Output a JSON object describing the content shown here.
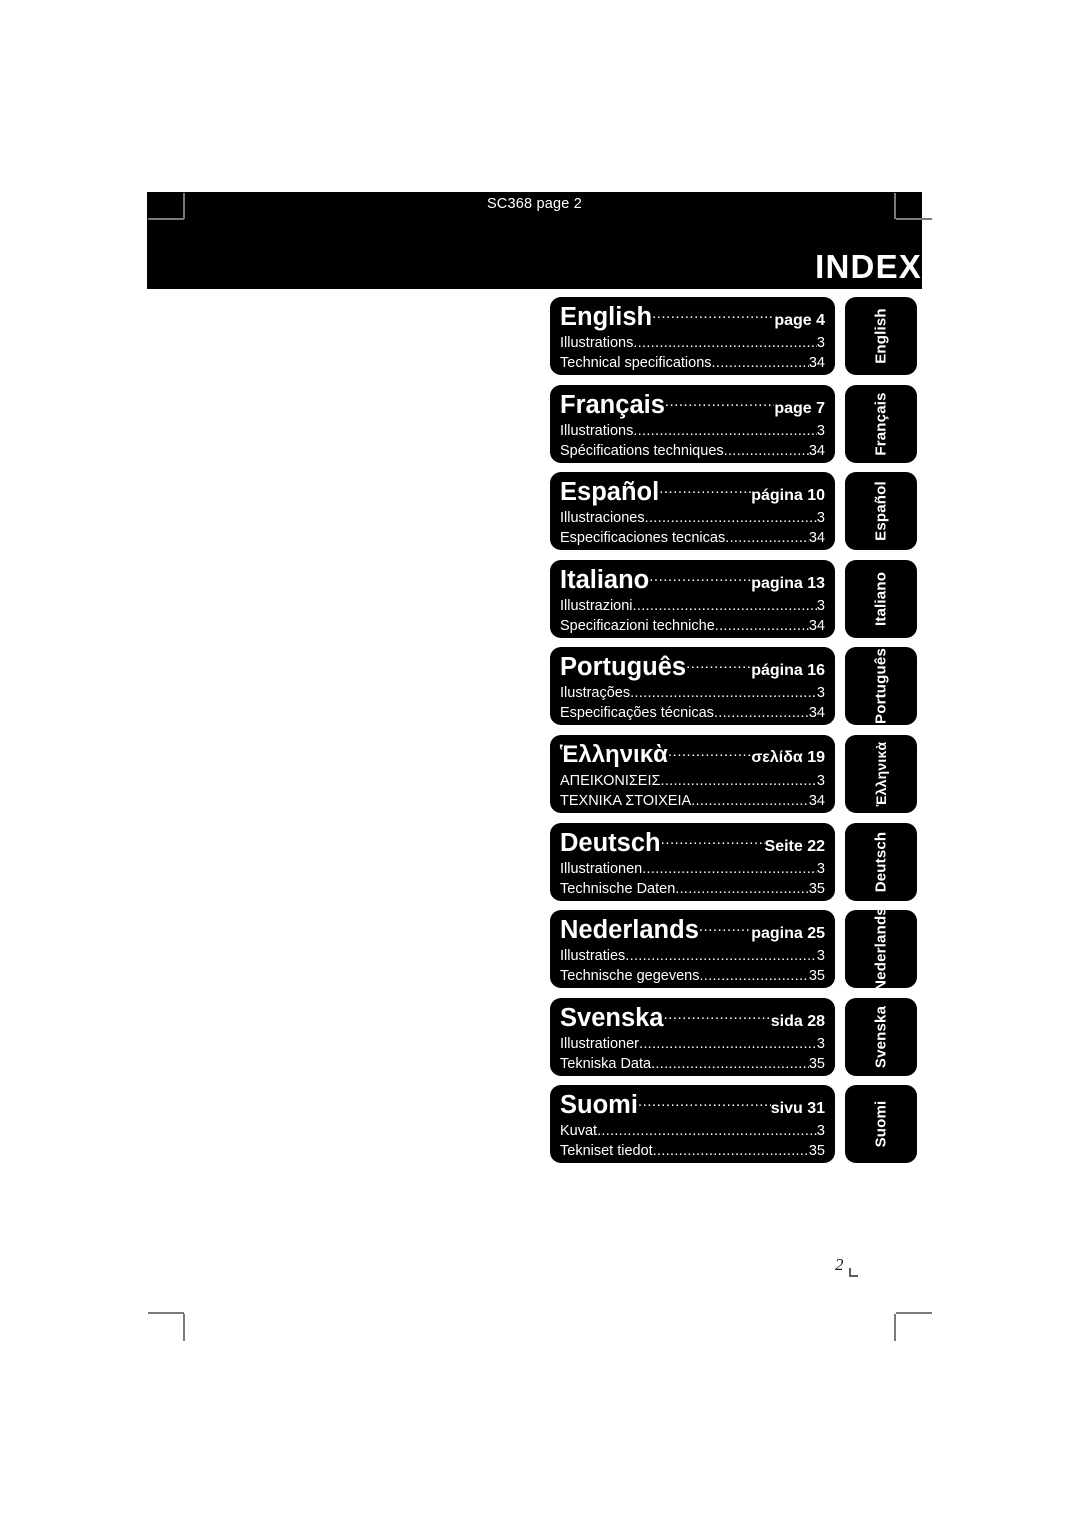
{
  "document": {
    "running_head": "SC368 page 2",
    "title": "INDEX",
    "folio": "2"
  },
  "languages": [
    {
      "name": "English",
      "page_ref": "page 4",
      "tab": "English",
      "entries": [
        {
          "label": "Illustrations",
          "page": "3"
        },
        {
          "label": "Technical specifications",
          "page": "34"
        }
      ]
    },
    {
      "name": "Français",
      "page_ref": "page 7",
      "tab": "Français",
      "entries": [
        {
          "label": "Illustrations",
          "page": "3"
        },
        {
          "label": "Spécifications techniques",
          "page": "34"
        }
      ]
    },
    {
      "name": "Español",
      "page_ref": "página 10",
      "tab": "Español",
      "entries": [
        {
          "label": "Illustraciones",
          "page": "3"
        },
        {
          "label": "Especificaciones tecnicas",
          "page": "34"
        }
      ]
    },
    {
      "name": "Italiano",
      "page_ref": "pagina 13",
      "tab": "Italiano",
      "entries": [
        {
          "label": "Illustrazioni",
          "page": "3"
        },
        {
          "label": "Specificazioni techniche",
          "page": "34"
        }
      ]
    },
    {
      "name": "Português",
      "page_ref": "página 16",
      "tab": "Português",
      "entries": [
        {
          "label": "Ilustrações",
          "page": "3"
        },
        {
          "label": "Especificações técnicas",
          "page": "34"
        }
      ]
    },
    {
      "name": "Ἑλληνικὰ",
      "page_ref": "σελίδα 19",
      "tab": "Ἑλληνικὰ",
      "entries": [
        {
          "label": "ΑΠΕΙΚΟΝΙΣΕΙΣ",
          "page": "3"
        },
        {
          "label": "ΤΕΧΝΙΚΑ ΣΤΟΙΧΕΙΑ",
          "page": "34"
        }
      ]
    },
    {
      "name": "Deutsch",
      "page_ref": "Seite 22",
      "tab": "Deutsch",
      "entries": [
        {
          "label": "Illustrationen",
          "page": "3"
        },
        {
          "label": "Technische Daten",
          "page": "35"
        }
      ]
    },
    {
      "name": "Nederlands",
      "page_ref": "pagina 25",
      "tab": "Nederlands",
      "entries": [
        {
          "label": "Illustraties",
          "page": "3"
        },
        {
          "label": "Technische gegevens",
          "page": "35"
        }
      ]
    },
    {
      "name": "Svenska",
      "page_ref": "sida  28",
      "tab": "Svenska",
      "entries": [
        {
          "label": "Illustrationer",
          "page": "3"
        },
        {
          "label": "Tekniska Data",
          "page": "35"
        }
      ]
    },
    {
      "name": "Suomi",
      "page_ref": "sivu 31",
      "tab": "Suomi",
      "entries": [
        {
          "label": "Kuvat",
          "page": "3"
        },
        {
          "label": "Tekniset tiedot",
          "page": "35"
        }
      ]
    }
  ],
  "colors": {
    "ink": "#000000",
    "paper": "#ffffff",
    "reverse_text": "#ffffff",
    "crop_mark": "#7a7a7a"
  }
}
